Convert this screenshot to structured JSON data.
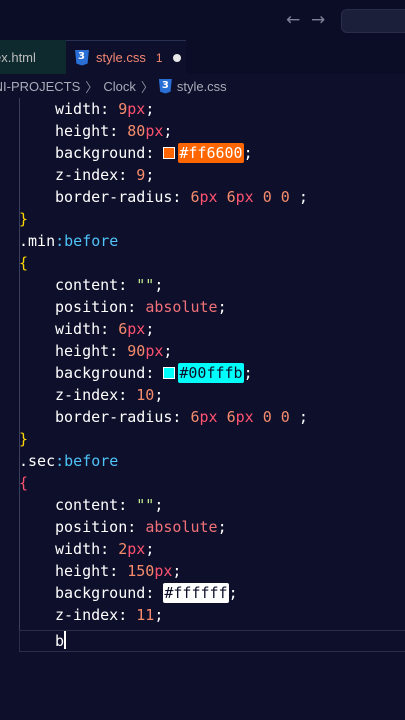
{
  "titlebar": {
    "back_icon": "arrow-left-icon",
    "forward_icon": "arrow-right-icon",
    "back_glyph": "←",
    "forward_glyph": "→"
  },
  "tabs": [
    {
      "label": "ex.html",
      "active": false
    },
    {
      "label": "style.css",
      "active": true,
      "problems": "1",
      "dirty": true
    }
  ],
  "breadcrumb": [
    "INI-PROJECTS",
    "Clock",
    "style.css"
  ],
  "breadcrumb_sep": "〉",
  "colors": {
    "hour_hand": "#ff6600",
    "min_hand": "#00fffb",
    "sec_hand": "#ffffff"
  },
  "code": {
    "l1": {
      "prop": "width",
      "num": "9",
      "unit": "px"
    },
    "l2": {
      "prop": "height",
      "num": "80",
      "unit": "px"
    },
    "l3": {
      "prop": "background",
      "hex": "#ff6600"
    },
    "l4": {
      "prop": "z-index",
      "num": "9"
    },
    "l5": {
      "prop": "border-radius",
      "a": "6",
      "b": "6",
      "c": "0",
      "d": "0"
    },
    "close1": "}",
    "min_selector": ".min",
    "pseudo": ":before",
    "open2": "{",
    "content_prop": "content",
    "content_val": "\"\"",
    "position_prop": "position",
    "position_val": "absolute",
    "min": {
      "width": "6",
      "height": "90",
      "hex": "#00fffb",
      "z": "10",
      "a": "6",
      "b": "6",
      "c": "0",
      "d": "0"
    },
    "close2": "}",
    "sec_selector": ".sec",
    "open3": "{",
    "sec": {
      "width": "2",
      "height": "150",
      "hex": "#ffffff",
      "z": "11"
    },
    "typing": "b"
  }
}
